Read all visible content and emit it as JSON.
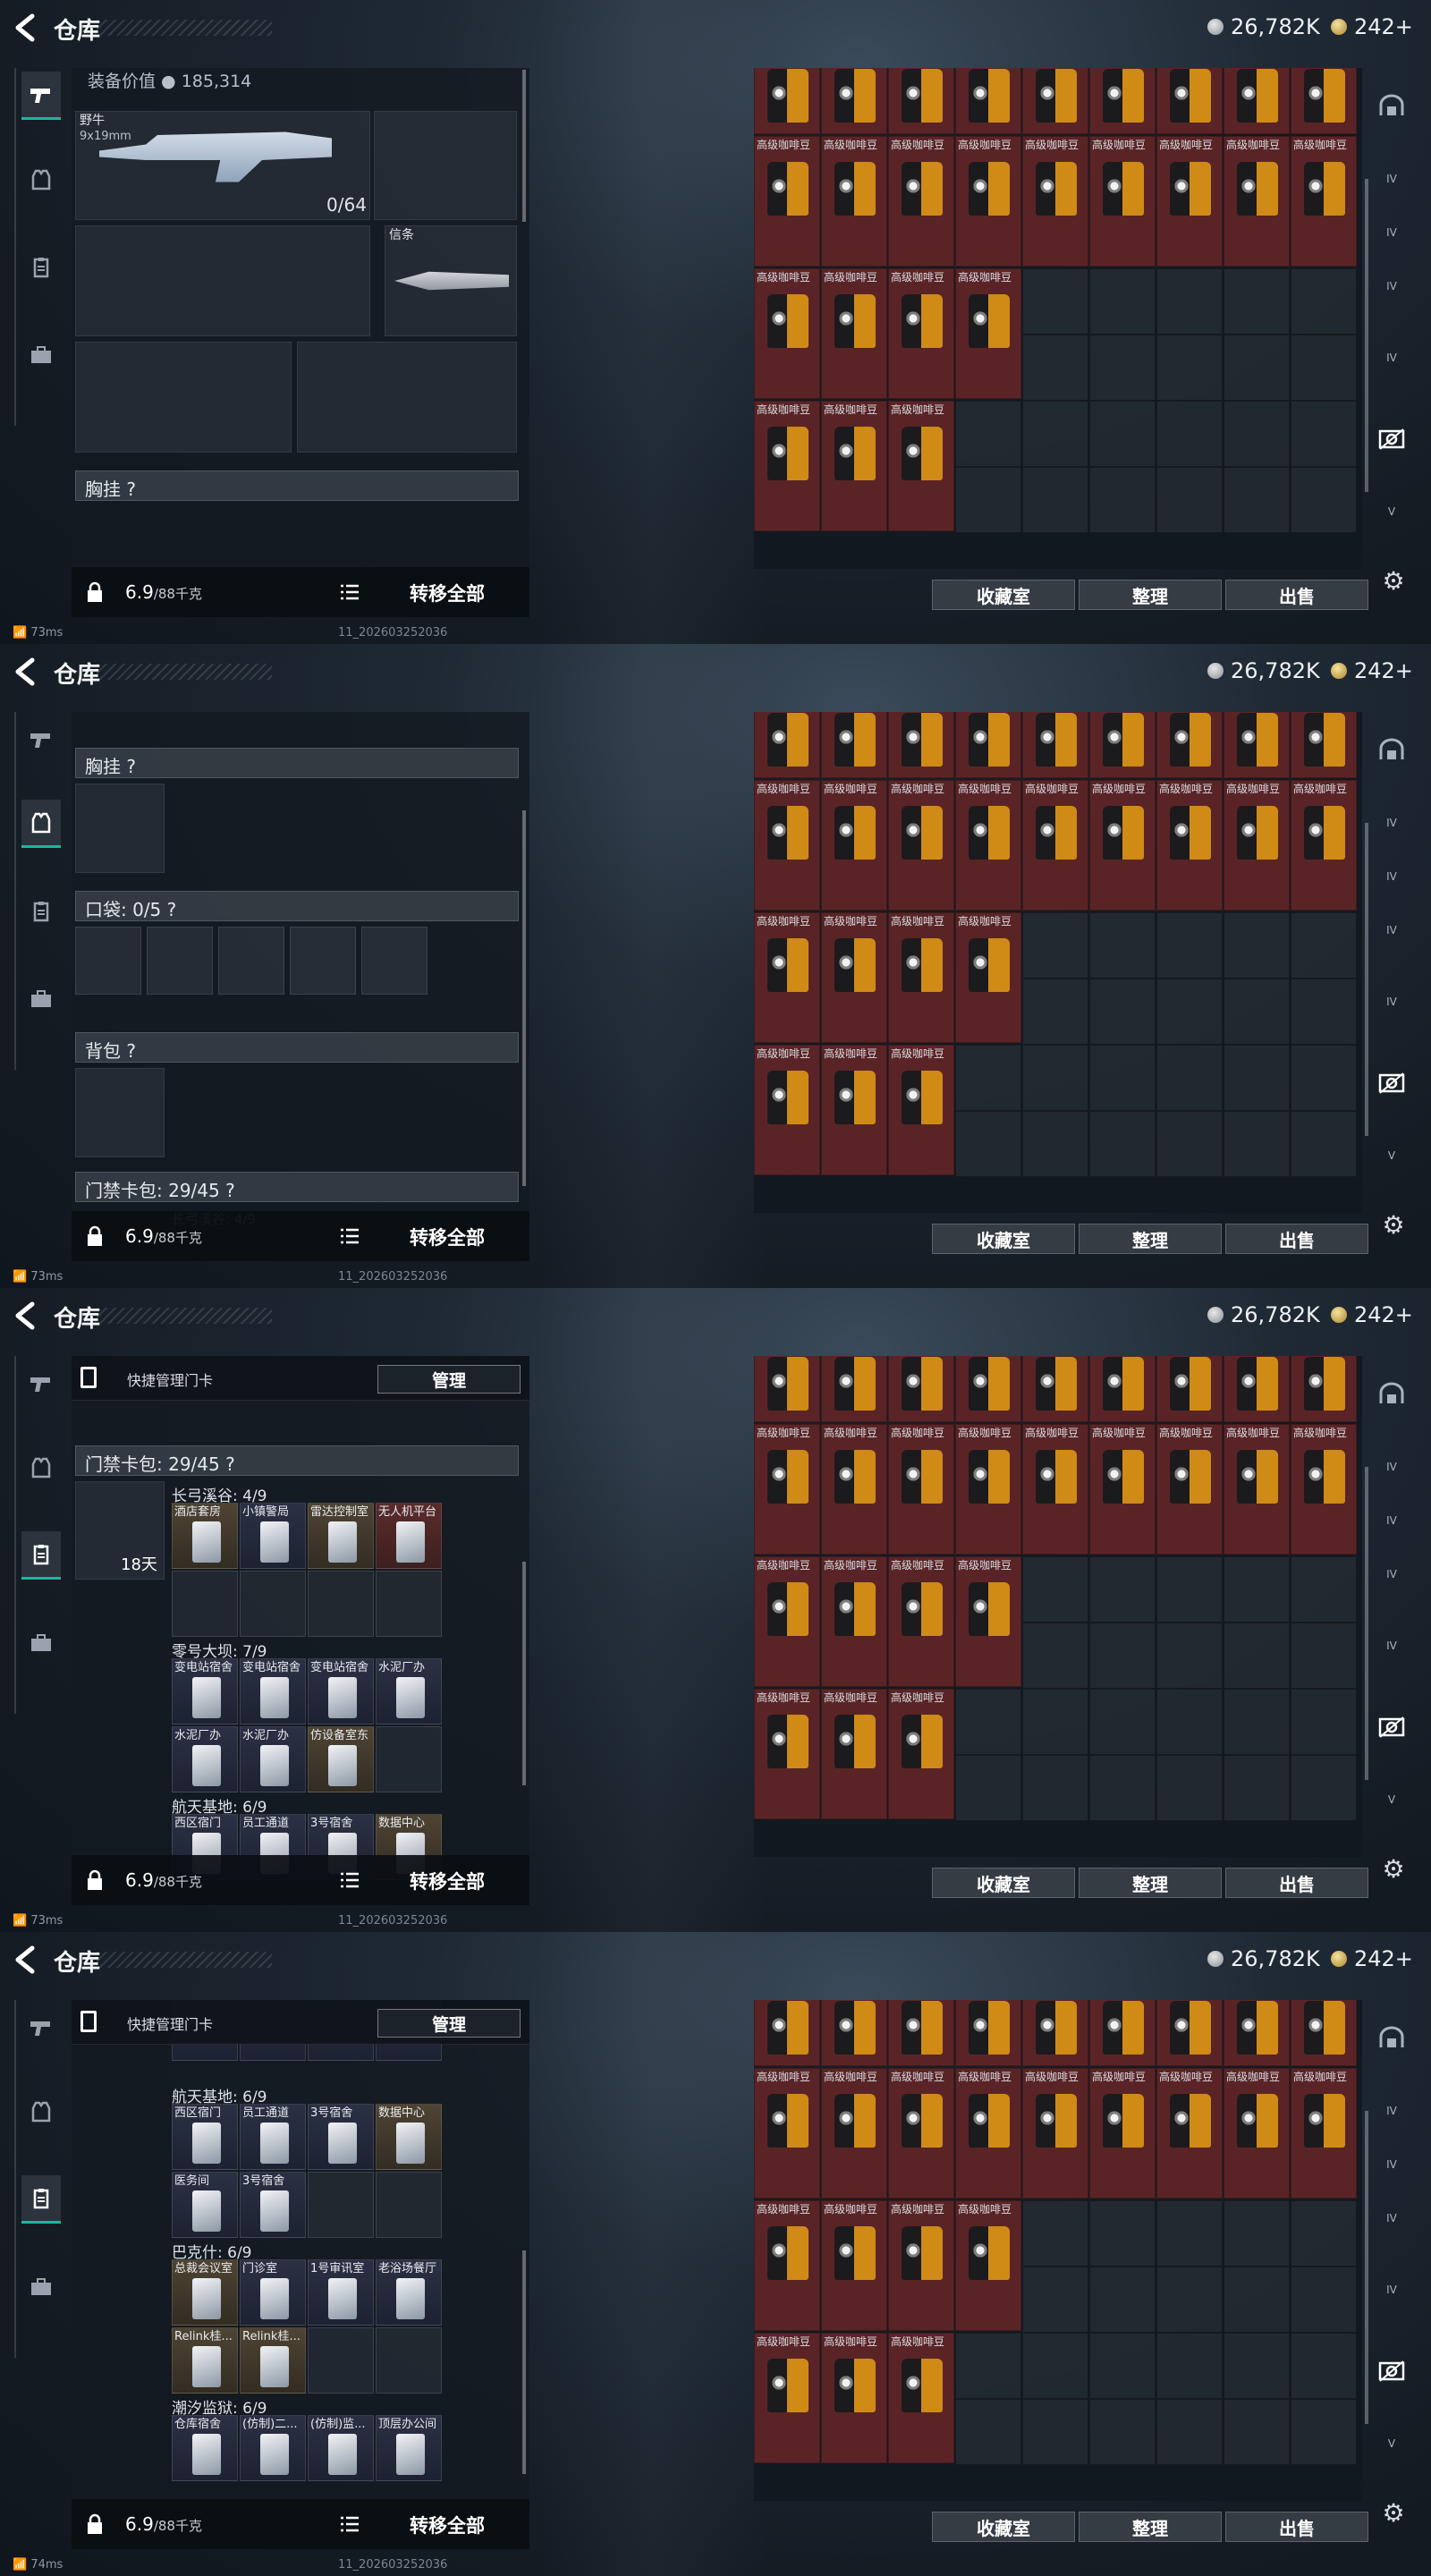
{
  "app": {
    "title": "仓库",
    "currency_silver": "26,782K",
    "currency_gold": "242+"
  },
  "left_panel": {
    "equip_value_label": "装备价值",
    "equip_value": "185,314",
    "weapon_name": "野牛",
    "weapon_ammo_type": "9x19mm",
    "weapon_ammo": "0/64",
    "melee_name": "信条",
    "chest_rig_label": "胸挂 ?",
    "pockets_label": "口袋: 0/5 ?",
    "backpack_label": "背包 ?",
    "keycard_label": "门禁卡包: 29/45 ?",
    "keycard_sub": "长弓溪谷: 4/9",
    "timer": "18天",
    "quick_manage_text": "快捷管理门卡",
    "manage_button": "管理"
  },
  "keycards": {
    "groups": [
      {
        "name": "长弓溪谷: 4/9",
        "cards": [
          "酒店套房",
          "小镇警局",
          "雷达控制室",
          "无人机平台"
        ]
      },
      {
        "name": "零号大坝: 7/9",
        "cards": [
          "变电站宿舍",
          "变电站宿舍",
          "变电站宿舍",
          "水泥厂办",
          "水泥厂办",
          "水泥厂办",
          "仿设备室东"
        ]
      },
      {
        "name": "航天基地: 6/9",
        "cards": [
          "西区宿门",
          "员工通道",
          "3号宿舍",
          "数据中心",
          "医务间",
          "3号宿舍"
        ]
      },
      {
        "name": "巴克什: 6/9",
        "cards": [
          "总裁会议室",
          "门诊室",
          "1号审讯室",
          "老浴场餐厅",
          "Relink桂...",
          "Relink桂..."
        ]
      },
      {
        "name": "潮汐监狱: 6/9",
        "cards": [
          "仓库宿舍",
          "(仿制)二...",
          "(仿制)监...",
          "顶层办公间"
        ]
      }
    ]
  },
  "bottom_bar": {
    "weight_current": "6.9",
    "weight_max": "/88千克",
    "transfer_all": "转移全部"
  },
  "stash": {
    "item_name": "高级咖啡豆",
    "buttons": [
      "收藏室",
      "整理",
      "出售"
    ]
  },
  "status": {
    "ping_1": "73ms",
    "ping_4": "74ms",
    "build": "11_202603252036"
  }
}
